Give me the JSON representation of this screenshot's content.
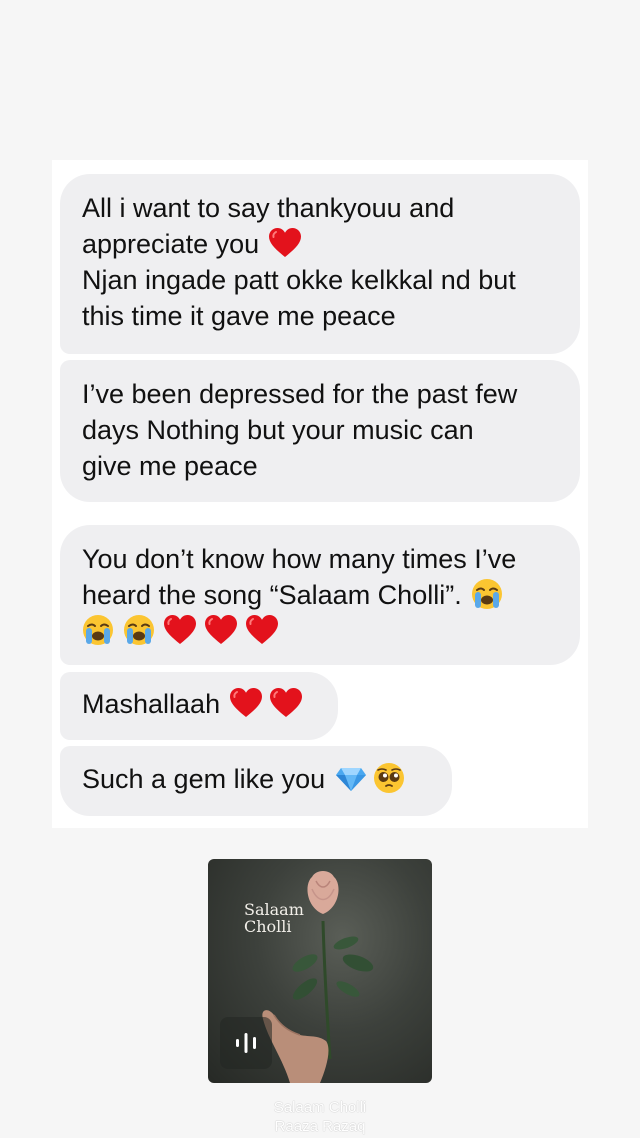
{
  "messages": [
    {
      "lines": [
        "All i want to say thankyouu and",
        "appreciate you",
        "Njan ingade patt okke kelkkal nd but",
        "this time it gave me peace"
      ],
      "emojis": [
        "red-heart"
      ]
    },
    {
      "lines": [
        "I’ve been depressed for the past few",
        "days Nothing but your music can",
        "give me peace"
      ]
    },
    {
      "lines": [
        "You don’t know how many times I’ve",
        "heard the song “Salaam Cholli”."
      ],
      "emojis": [
        "loudly-crying-face",
        "loudly-crying-face",
        "loudly-crying-face",
        "red-heart",
        "red-heart",
        "red-heart"
      ]
    },
    {
      "lines": [
        "Mashallaah"
      ],
      "emojis": [
        "red-heart",
        "red-heart"
      ]
    },
    {
      "lines": [
        "Such a gem like you"
      ],
      "emojis": [
        "gem-stone",
        "pleading-face"
      ]
    }
  ],
  "music": {
    "album_title_line1": "Salaam",
    "album_title_line2": "Cholli",
    "song_title": "Salaam Cholli",
    "artist": "Raaza Razaq",
    "icon": "audio-waveform-icon"
  },
  "colors": {
    "background": "#f6f6f6",
    "bubble": "#efeff1",
    "text": "#111111",
    "heart": "#e3121c"
  }
}
